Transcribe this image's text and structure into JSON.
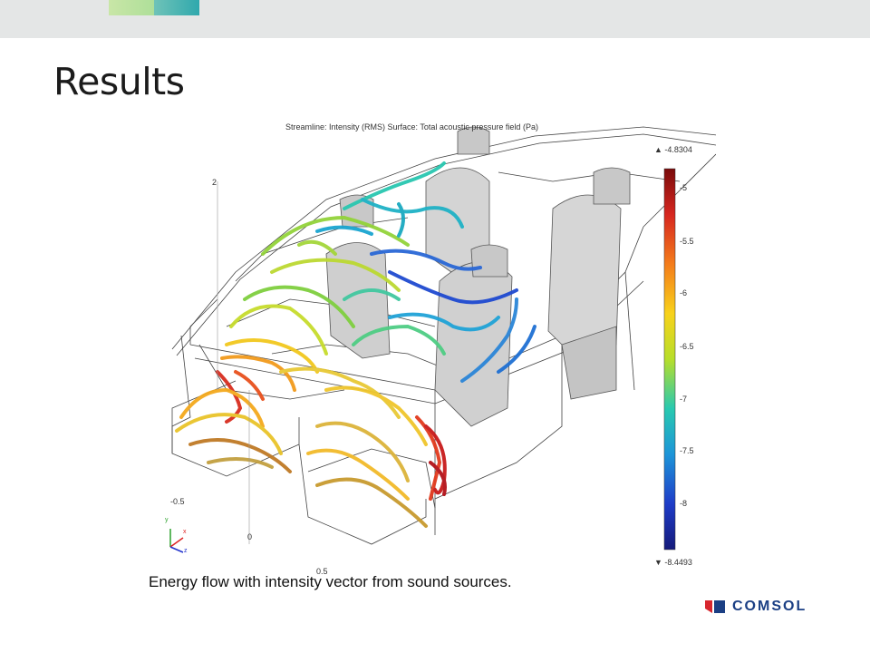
{
  "slide": {
    "title": "Results",
    "caption": "Energy flow with intensity vector from sound sources."
  },
  "plot": {
    "title": "Streamline: Intensity (RMS)  Surface: Total acoustic pressure field (Pa)",
    "axis_ticks": {
      "z_top": "2",
      "x_left": "-0.5",
      "x_zero": "0",
      "x_bottom": "0.5"
    },
    "triad": {
      "y": "y",
      "x": "x",
      "z": "z"
    },
    "colorbar": {
      "max_label": "▲ -4.8304",
      "min_label": "▼ -8.4493",
      "ticks": [
        "-5",
        "-5.5",
        "-6",
        "-6.5",
        "-7",
        "-7.5",
        "-8"
      ],
      "colors": [
        "#7a0b0b",
        "#d6261f",
        "#f47c1b",
        "#f8d21b",
        "#b7de2a",
        "#28c9b0",
        "#1d95d8",
        "#1e3cc8",
        "#151a7a"
      ]
    }
  },
  "brand": {
    "name": "COMSOL",
    "color": "#1b3f84",
    "accent": "#d7262e"
  }
}
